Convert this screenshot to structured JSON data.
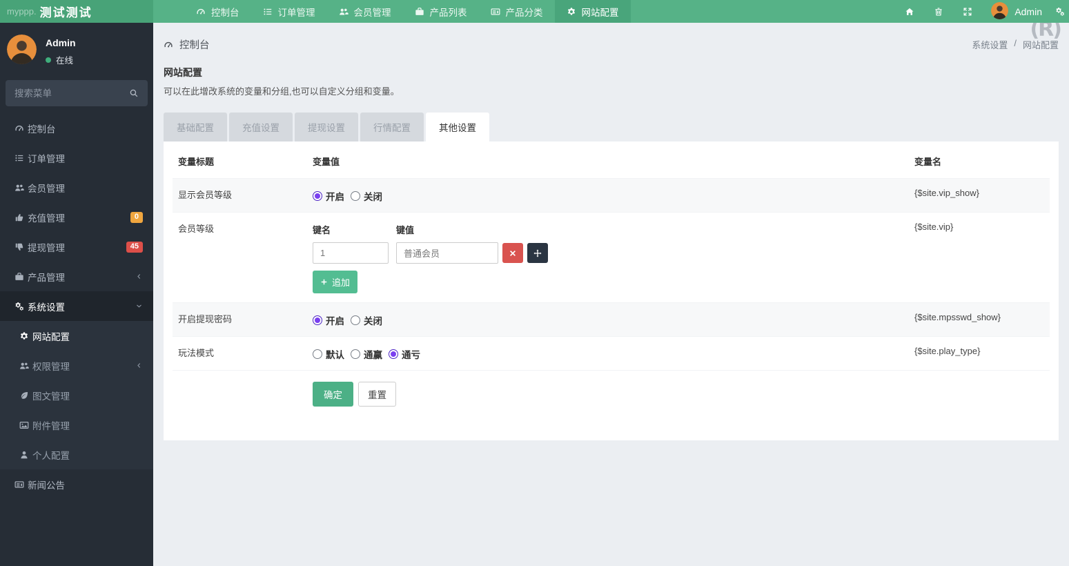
{
  "brand": {
    "prefix": "myppp.",
    "name": "测试测试"
  },
  "navbar": {
    "items": [
      {
        "label": "控制台",
        "icon": "gauge"
      },
      {
        "label": "订单管理",
        "icon": "list"
      },
      {
        "label": "会员管理",
        "icon": "users"
      },
      {
        "label": "产品列表",
        "icon": "briefcase"
      },
      {
        "label": "产品分类",
        "icon": "newspaper"
      },
      {
        "label": "网站配置",
        "icon": "gear",
        "active": true
      }
    ],
    "right_icons": [
      {
        "name": "home"
      },
      {
        "name": "trash"
      },
      {
        "name": "expand"
      }
    ],
    "user": {
      "name": "Admin",
      "avatar_icon": "avatar"
    },
    "settings_icon": "gears"
  },
  "watermark": "(R)",
  "sidebar": {
    "user": {
      "name": "Admin",
      "status": "在线"
    },
    "search_placeholder": "搜索菜单",
    "menu": [
      {
        "label": "控制台",
        "icon": "gauge"
      },
      {
        "label": "订单管理",
        "icon": "list"
      },
      {
        "label": "会员管理",
        "icon": "users"
      },
      {
        "label": "充值管理",
        "icon": "thumbs-up",
        "badge": {
          "text": "0",
          "color": "#f0a63f"
        }
      },
      {
        "label": "提现管理",
        "icon": "thumbs-down",
        "badge": {
          "text": "45",
          "color": "#dd4f49"
        }
      },
      {
        "label": "产品管理",
        "icon": "briefcase",
        "chevron": "left"
      },
      {
        "label": "系统设置",
        "icon": "gears",
        "chevron": "down",
        "open": true,
        "children": [
          {
            "label": "网站配置",
            "icon": "gear",
            "active": true
          },
          {
            "label": "权限管理",
            "icon": "users",
            "chevron": "left"
          },
          {
            "label": "图文管理",
            "icon": "leaf"
          },
          {
            "label": "附件管理",
            "icon": "image"
          },
          {
            "label": "个人配置",
            "icon": "user"
          }
        ]
      },
      {
        "label": "新闻公告",
        "icon": "newspaper"
      }
    ]
  },
  "content": {
    "header": {
      "title": "控制台",
      "icon": "gauge",
      "breadcrumb": [
        "系统设置",
        "网站配置"
      ],
      "breadcrumb_sep": "/"
    },
    "panel": {
      "title": "网站配置",
      "subtitle": "可以在此增改系统的变量和分组,也可以自定义分组和变量。",
      "tabs": [
        {
          "label": "基础配置"
        },
        {
          "label": "充值设置"
        },
        {
          "label": "提现设置"
        },
        {
          "label": "行情配置"
        },
        {
          "label": "其他设置",
          "active": true
        }
      ],
      "table": {
        "headers": [
          "变量标题",
          "变量值",
          "变量名"
        ],
        "rows": [
          {
            "title": "显示会员等级",
            "type": "radio",
            "shaded": true,
            "options": [
              {
                "label": "开启",
                "checked": true
              },
              {
                "label": "关闭"
              }
            ],
            "variable": "{$site.vip_show}"
          },
          {
            "title": "会员等级",
            "type": "kv",
            "kv": {
              "key_label": "键名",
              "value_label": "键值",
              "key": "1",
              "value": "普通会员",
              "add_label": "追加"
            },
            "variable": "{$site.vip}"
          },
          {
            "title": "开启提现密码",
            "type": "radio",
            "shaded": true,
            "options": [
              {
                "label": "开启",
                "checked": true
              },
              {
                "label": "关闭"
              }
            ],
            "variable": "{$site.mpsswd_show}"
          },
          {
            "title": "玩法模式",
            "type": "radio",
            "options": [
              {
                "label": "默认"
              },
              {
                "label": "通赢"
              },
              {
                "label": "通亏",
                "checked": true
              }
            ],
            "variable": "{$site.play_type}"
          }
        ],
        "buttons": [
          {
            "label": "确定",
            "style": "primary"
          },
          {
            "label": "重置",
            "style": "default"
          }
        ]
      }
    }
  },
  "colors": {
    "navbar_green": "#56b287",
    "brand_green": "#48a378",
    "nav_active_green": "#49a57b",
    "sidebar_dark": "#262d36",
    "submenu_dark": "#2b333d",
    "badge_orange": "#f0a63f",
    "badge_red": "#dd4f49",
    "radio_purple": "#7a3ff0",
    "danger_red": "#d9534f",
    "move_dark": "#2b3542",
    "confirm_green": "#4cb086",
    "append_green": "#53bd92",
    "page_bg": "#ebeef2"
  }
}
